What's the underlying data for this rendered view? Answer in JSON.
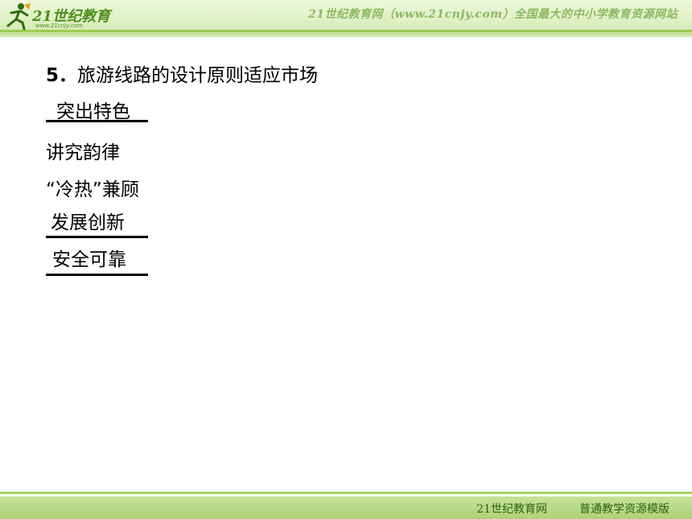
{
  "header": {
    "logo_text": "21世纪教育",
    "logo_url": "www.21cnjy.com",
    "slogan": "21世纪教育网（www.21cnjy.com）全国最大的中小学教育资源网站"
  },
  "content": {
    "heading_number": "5．",
    "heading_text": "旅游线路的设计原则适应市场",
    "items": [
      "突出特色",
      "讲究韵律",
      "“冷热”兼顾",
      "发展创新",
      "安全可靠"
    ]
  },
  "footer": {
    "site_name": "21世纪教育网",
    "template_name": "普通教学资源模版"
  },
  "colors": {
    "header_green": "#9ccc55",
    "footer_green": "#add27a",
    "text": "#000000"
  }
}
